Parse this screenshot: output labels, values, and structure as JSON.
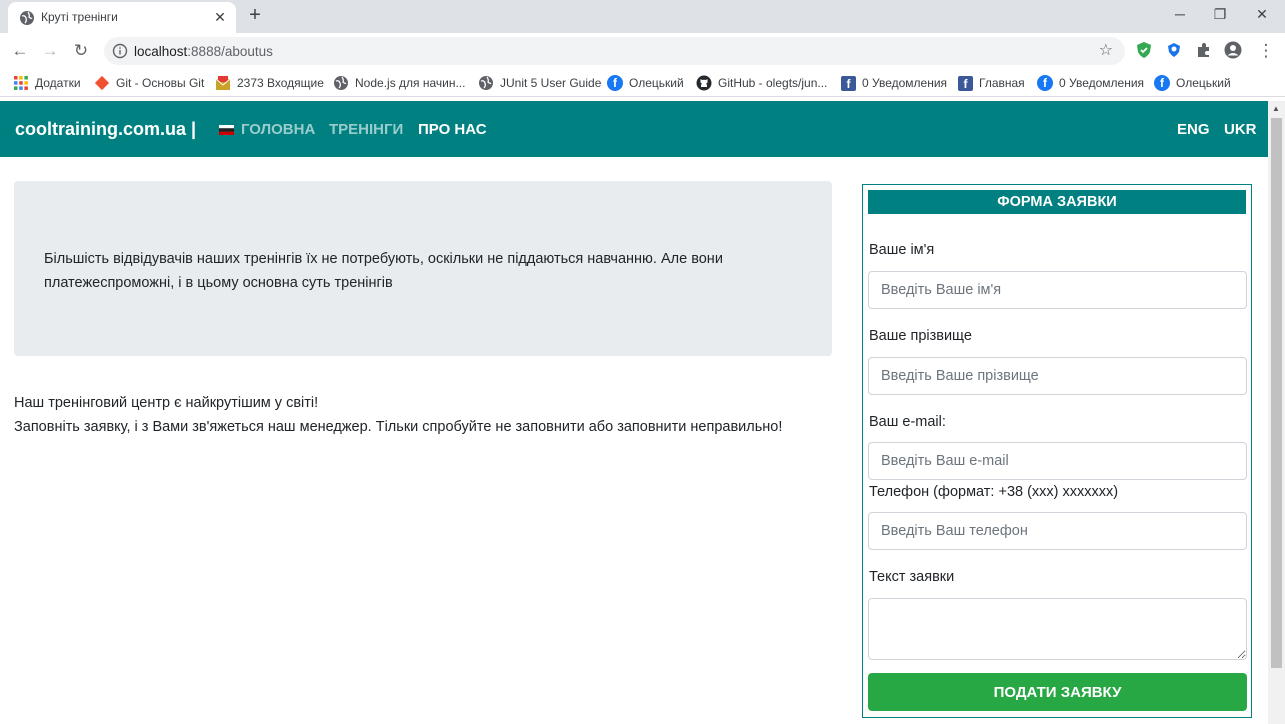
{
  "browser": {
    "tab_title": "Круті тренінги",
    "url_host": "localhost",
    "url_rest": ":8888/aboutus",
    "bookmarks": [
      {
        "label": "Додатки",
        "icon": "apps-grid-icon"
      },
      {
        "label": "Git - Основы Git",
        "icon": "git-icon"
      },
      {
        "label": "2373 Входящие",
        "icon": "mail-icon"
      },
      {
        "label": "Node.js для начин...",
        "icon": "globe-icon"
      },
      {
        "label": "JUnit 5 User Guide",
        "icon": "globe-icon"
      },
      {
        "label": "Олецький",
        "icon": "facebook-icon"
      },
      {
        "label": "GitHub - olegts/jun...",
        "icon": "github-icon"
      },
      {
        "label": "0 Уведомления",
        "icon": "facebook-square-icon"
      },
      {
        "label": "Главная",
        "icon": "facebook-square-icon"
      },
      {
        "label": "0 Уведомления",
        "icon": "facebook-icon"
      },
      {
        "label": "Олецький",
        "icon": "facebook-icon"
      }
    ]
  },
  "site": {
    "brand": "cooltraining.com.ua |",
    "nav": {
      "home": "ГОЛОВНА",
      "trainings": "ТРЕНІНГИ",
      "about": "ПРО НАС"
    },
    "lang": {
      "eng": "ENG",
      "ukr": "UKR"
    },
    "colors": {
      "primary": "#008080",
      "submit": "#28a745",
      "jumbotron": "#e9ecef"
    }
  },
  "content": {
    "jumbotron_text": "Більшість відвідувачів наших тренінгів їх не потребують, оскільки не піддаються навчанню. Але вони платежеспроможні, і в цьому основна суть тренінгів",
    "line1": "Наш тренінговий центр є найкрутішим у світі!",
    "line2": "Заповніть заявку, і з Вами зв'яжеться наш менеджер. Тільки спробуйте не заповнити або заповнити неправильно!"
  },
  "form": {
    "title": "ФОРМА ЗАЯВКИ",
    "name_label": "Ваше ім'я",
    "name_placeholder": "Введіть Ваше ім'я",
    "surname_label": "Ваше прізвище",
    "surname_placeholder": "Введіть Ваше прізвище",
    "email_label": "Ваш e-mail:",
    "email_placeholder": "Введіть Ваш e-mail",
    "phone_label": "Телефон (формат: +38 (xxx) xxxxxxx)",
    "phone_placeholder": "Введіть Ваш телефон",
    "text_label": "Текст заявки",
    "submit": "ПОДАТИ ЗАЯВКУ"
  }
}
